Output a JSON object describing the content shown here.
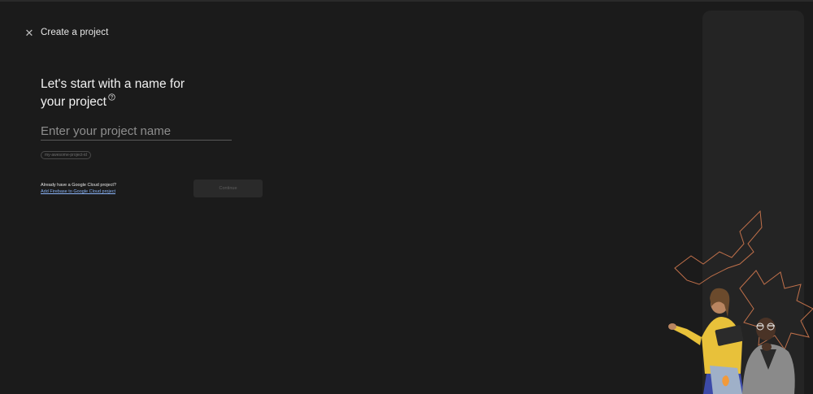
{
  "header": {
    "close_icon": "close-icon",
    "title": "Create a project"
  },
  "main": {
    "heading_line1": "Let's start with a name for",
    "heading_line2": "your project",
    "help_icon": "help-circle-icon",
    "name_input": {
      "placeholder": "Enter your project name",
      "value": ""
    },
    "project_id_chip": "my-awesome-project-id",
    "already_text": "Already have a Google Cloud project?",
    "add_link": "Add Firebase to Google Cloud project",
    "continue_label": "Continue"
  },
  "colors": {
    "background": "#1b1b1b",
    "panel": "#242424",
    "link": "#8ab4f8",
    "accent_outline": "#c0704a"
  }
}
